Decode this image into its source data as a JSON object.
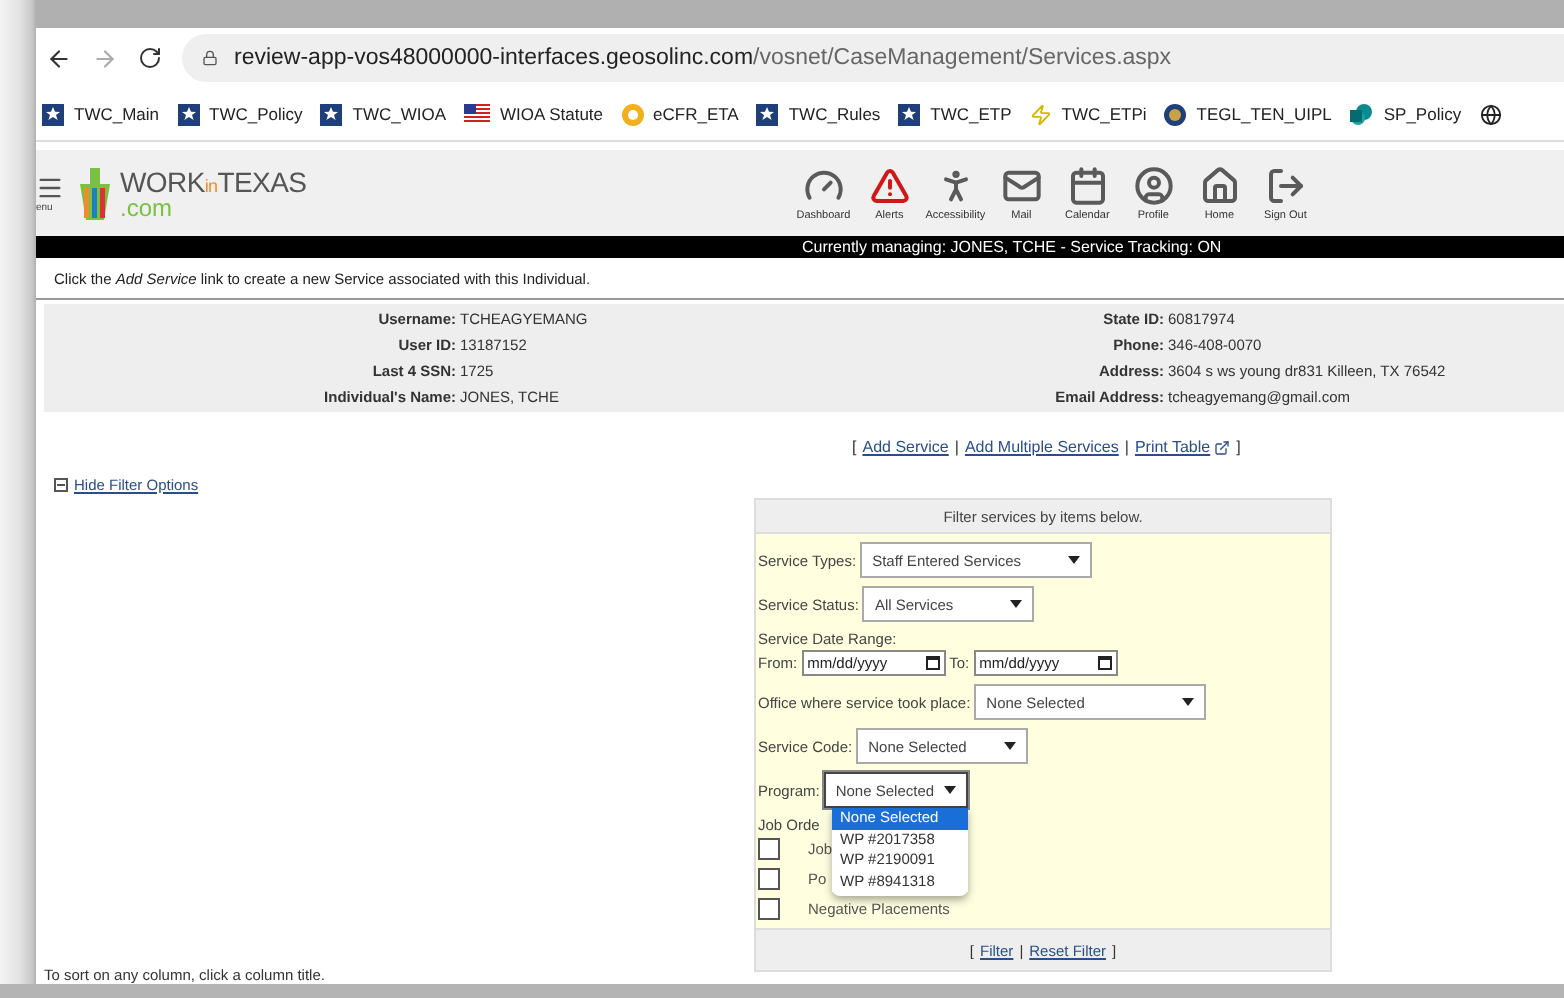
{
  "browser": {
    "url_host": "review-app-vos48000000-interfaces.geosolinc.com",
    "url_path": "/vosnet/CaseManagement/Services.aspx"
  },
  "bookmarks": [
    {
      "label": "TWC_Main",
      "kind": "star"
    },
    {
      "label": "TWC_Policy",
      "kind": "star"
    },
    {
      "label": "TWC_WIOA",
      "kind": "star"
    },
    {
      "label": "WIOA Statute",
      "kind": "flag"
    },
    {
      "label": "eCFR_ETA",
      "kind": "coin"
    },
    {
      "label": "TWC_Rules",
      "kind": "star"
    },
    {
      "label": "TWC_ETP",
      "kind": "star"
    },
    {
      "label": "TWC_ETPi",
      "kind": "bolt"
    },
    {
      "label": "TEGL_TEN_UIPL",
      "kind": "seal"
    },
    {
      "label": "SP_Policy",
      "kind": "cloud"
    }
  ],
  "bookmark_overflow": {
    "kind": "globe"
  },
  "header": {
    "menu_label": "enu",
    "logo": {
      "work": "WORK",
      "in": "in",
      "texas": "TEXAS",
      "com": ".com"
    }
  },
  "nav": [
    {
      "label": "Dashboard",
      "kind": "gauge"
    },
    {
      "label": "Alerts",
      "kind": "alert"
    },
    {
      "label": "Accessibility",
      "kind": "person"
    },
    {
      "label": "Mail",
      "kind": "mail"
    },
    {
      "label": "Calendar",
      "kind": "calendar"
    },
    {
      "label": "Profile",
      "kind": "profile"
    },
    {
      "label": "Home",
      "kind": "home"
    },
    {
      "label": "Sign Out",
      "kind": "signout"
    }
  ],
  "managing_bar": "Currently managing: JONES, TCHE - Service Tracking: ON",
  "instruction": "Click the *Add Service* link to create a new Service associated with this Individual.",
  "info": {
    "left": [
      {
        "label": "Username:",
        "value": "TCHEAGYEMANG"
      },
      {
        "label": "User ID:",
        "value": "13187152"
      },
      {
        "label": "Last 4 SSN:",
        "value": "1725"
      },
      {
        "label": "Individual's Name:",
        "value": "JONES, TCHE"
      }
    ],
    "right": [
      {
        "label": "State ID:",
        "value": "60817974"
      },
      {
        "label": "Phone:",
        "value": "346-408-0070"
      },
      {
        "label": "Address:",
        "value": "3604 s ws young dr831 Killeen, TX 76542"
      },
      {
        "label": "Email Address:",
        "value": "tcheagyemang@gmail.com"
      }
    ]
  },
  "action_marks": {
    "open": "[",
    "separator": "|",
    "close": "]"
  },
  "actions": [
    {
      "label": "Add Service",
      "external": false
    },
    {
      "label": "Add Multiple Services",
      "external": false
    },
    {
      "label": "Print Table",
      "external": true
    }
  ],
  "filter_toggle": "Hide Filter Options",
  "filter": {
    "title": "Filter services by items below.",
    "fields": [
      {
        "kind": "select",
        "label": "Service Types:",
        "value": "Staff Entered Services"
      },
      {
        "kind": "select",
        "label": "Service Status:",
        "value": "All Services"
      },
      {
        "kind": "heading",
        "label": "Service Date Range:"
      },
      {
        "kind": "daterange",
        "from_label": "From:",
        "from_placeholder": "mm/dd/yyyy",
        "to_label": "To:",
        "to_placeholder": "mm/dd/yyyy"
      },
      {
        "kind": "select",
        "label": "Office where service took place:",
        "value": "None Selected"
      },
      {
        "kind": "select",
        "label": "Service Code:",
        "value": "None Selected"
      },
      {
        "kind": "select",
        "label": "Program:",
        "value": "None Selected",
        "expanded": true,
        "options": [
          {
            "label": "None Selected",
            "selected": true
          },
          {
            "label": "WP #2017358",
            "selected": false
          },
          {
            "label": "WP #2190091",
            "selected": false
          },
          {
            "label": "WP #8941318",
            "selected": false
          }
        ]
      }
    ],
    "job_order_label": "Job Orde",
    "checkboxes": [
      {
        "label": "Job",
        "checked": false
      },
      {
        "label": "Po",
        "checked": false
      },
      {
        "label": "Negative Placements",
        "checked": false
      }
    ],
    "footer_marks": {
      "open": "[",
      "separator": "|",
      "close": "]"
    },
    "footer_links": [
      "Filter",
      "Reset Filter"
    ]
  },
  "sort_hint": "To sort on any column, click a column title."
}
